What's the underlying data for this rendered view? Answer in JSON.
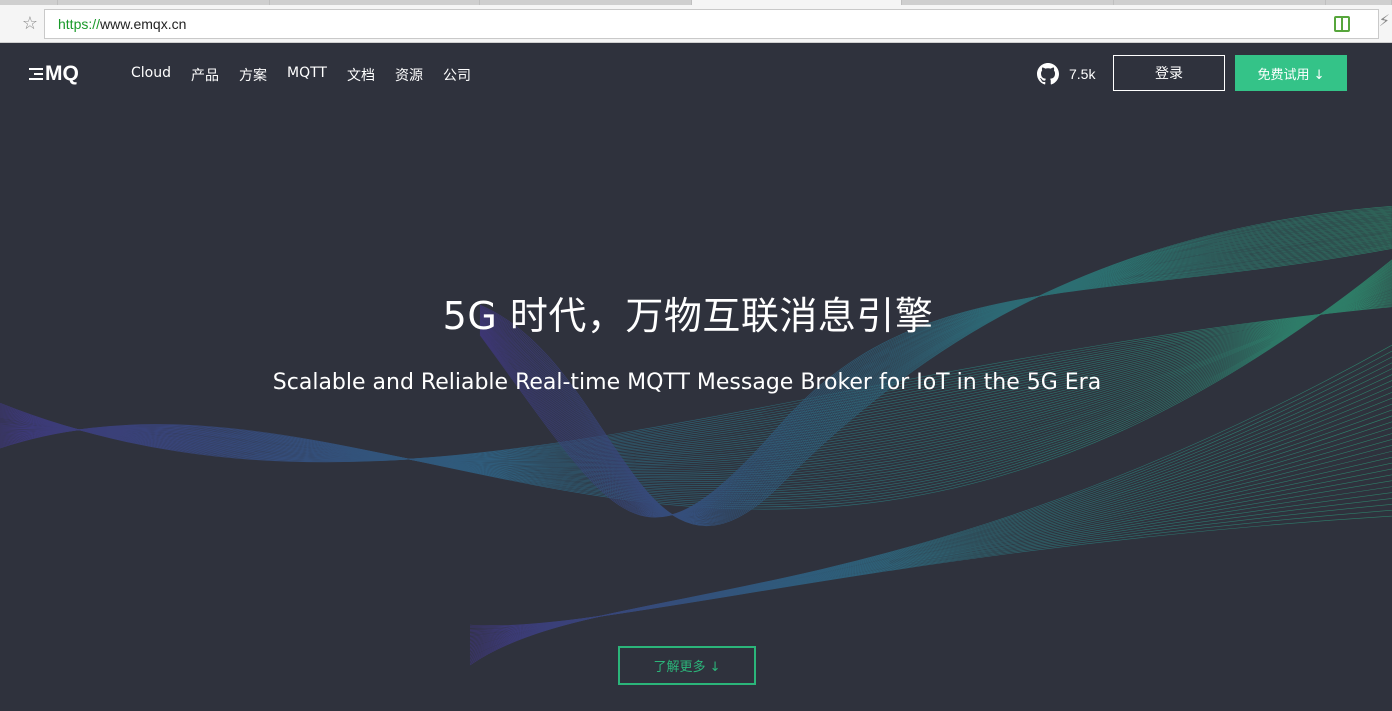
{
  "browser": {
    "url_protocol": "https://",
    "url_rest": "www.emqx.cn"
  },
  "header": {
    "logo_text": "MQ",
    "nav": [
      "Cloud",
      "产品",
      "方案",
      "MQTT",
      "文档",
      "资源",
      "公司"
    ],
    "github_stars": "7.5k",
    "login_label": "登录",
    "trial_label": "免费试用 ↓"
  },
  "hero": {
    "title": "5G 时代，万物互联消息引擎",
    "subtitle": "Scalable and Reliable Real-time MQTT Message Broker for IoT in the 5G Era",
    "more_label": "了解更多 ↓"
  },
  "colors": {
    "background": "#2f323d",
    "accent_green": "#34c388",
    "wave_teal": "#2aa8a0",
    "wave_purple": "#5a3fc0"
  },
  "icons": [
    "star-icon",
    "reader-icon",
    "flash-icon",
    "github-icon",
    "logo-bars-icon"
  ]
}
